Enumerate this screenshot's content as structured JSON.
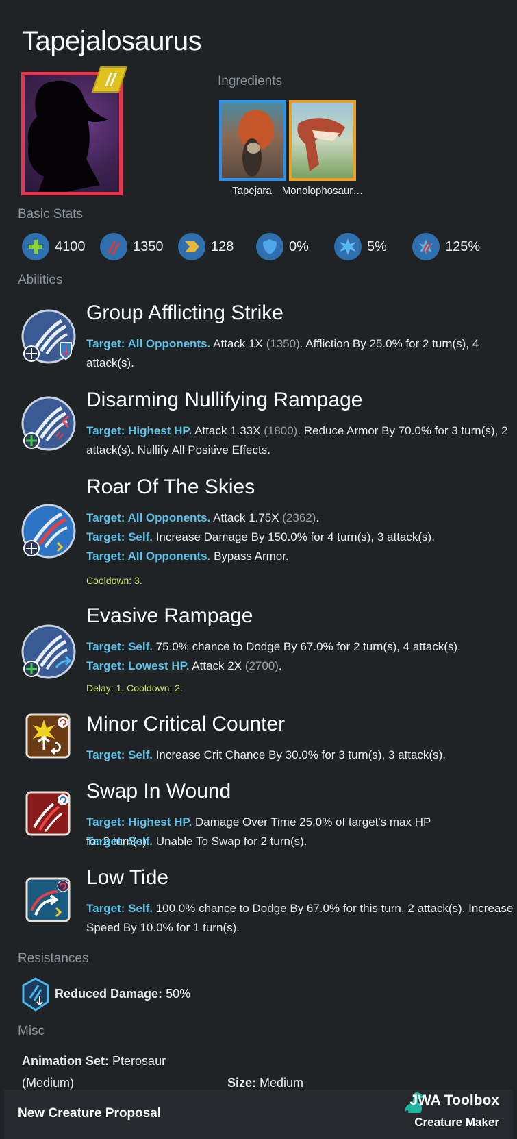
{
  "creature": {
    "name": "Tapejalosaurus"
  },
  "ingredients": {
    "heading": "Ingredients",
    "items": [
      {
        "name": "Tapejara",
        "rarity_color": "#2d8ee8"
      },
      {
        "name": "Monolophosaur…",
        "rarity_color": "#f0a020"
      }
    ]
  },
  "basic_stats": {
    "heading": "Basic Stats",
    "items": [
      {
        "icon": "health-icon",
        "value": "4100"
      },
      {
        "icon": "damage-icon",
        "value": "1350"
      },
      {
        "icon": "speed-icon",
        "value": "128"
      },
      {
        "icon": "armor-icon",
        "value": "0%"
      },
      {
        "icon": "crit-chance-icon",
        "value": "5%"
      },
      {
        "icon": "crit-multiplier-icon",
        "value": "125%"
      }
    ]
  },
  "abilities": {
    "heading": "Abilities",
    "items": [
      {
        "name": "Group Afflicting Strike",
        "lines": [
          {
            "target": "Target: All Opponents.",
            "pre": " Attack 1X ",
            "num": "(1350)",
            "post": ". Affliction By 25.0% for 2 turn(s), 4 attack(s)."
          }
        ]
      },
      {
        "name": "Disarming Nullifying Rampage",
        "lines": [
          {
            "target": "Target: Highest HP.",
            "pre": " Attack 1.33X ",
            "num": "(1800)",
            "post": ". Reduce Armor By 70.0% for 3 turn(s), 2 attack(s). Nullify All Positive Effects."
          }
        ]
      },
      {
        "name": "Roar Of The Skies",
        "lines": [
          {
            "target": "Target: All Opponents.",
            "pre": " Attack 1.75X ",
            "num": "(2362)",
            "post": "."
          },
          {
            "target": "Target: Self.",
            "pre": " Increase Damage By 150.0% for 4 turn(s), 3 attack(s).",
            "num": "",
            "post": ""
          },
          {
            "target": "Target: All Opponents.",
            "pre": " Bypass Armor.",
            "num": "",
            "post": ""
          }
        ],
        "note": "Cooldown: 3."
      },
      {
        "name": "Evasive Rampage",
        "lines": [
          {
            "target": "Target: Self.",
            "pre": " 75.0% chance to Dodge By 67.0% for 2 turn(s), 4 attack(s).",
            "num": "",
            "post": ""
          },
          {
            "target": "Target: Lowest HP.",
            "pre": " Attack 2X ",
            "num": "(2700)",
            "post": "."
          }
        ],
        "note": "Delay: 1. Cooldown: 2."
      },
      {
        "name": "Minor Critical Counter",
        "lines": [
          {
            "target": "Target: Self.",
            "pre": " Increase Crit Chance By 30.0% for 3 turn(s), 3 attack(s).",
            "num": "",
            "post": ""
          }
        ]
      },
      {
        "name": "Swap In Wound",
        "lines": [
          {
            "target": "Target: Highest HP.",
            "pre": " Damage Over Time 25.0% of target's max HP for 2 turn(s).",
            "num": "",
            "post": ""
          },
          {
            "target": "Target: Self.",
            "pre": " Unable To Swap for 2 turn(s).",
            "num": "",
            "post": ""
          }
        ]
      },
      {
        "name": "Low Tide",
        "lines": [
          {
            "target": "Target: Self.",
            "pre": " 100.0% chance to Dodge By 67.0% for this turn, 2 attack(s). Increase Speed By 10.0% for 1 turn(s).",
            "num": "",
            "post": ""
          }
        ]
      }
    ]
  },
  "resistances": {
    "heading": "Resistances",
    "label": "Reduced Damage:",
    "value": "50%"
  },
  "misc": {
    "heading": "Misc",
    "animation_label": "Animation Set:",
    "animation_value": "Pterosaur",
    "animation_sub": "(Medium)",
    "size_label": "Size:",
    "size_value": "Medium"
  },
  "footer": {
    "left": "New Creature Proposal",
    "brand": "JWA Toolbox",
    "sub": "Creature Maker"
  }
}
